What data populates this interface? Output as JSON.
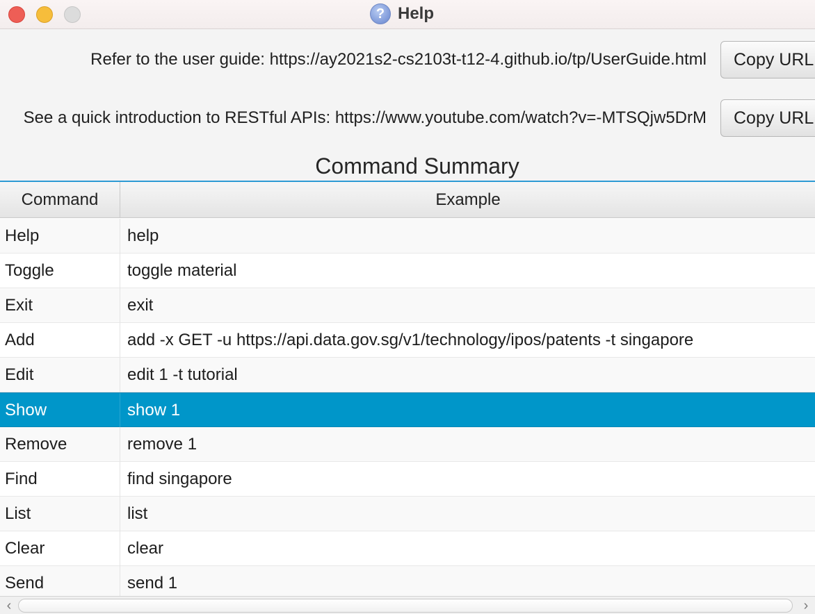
{
  "window": {
    "title": "Help"
  },
  "links": [
    {
      "text": "Refer to the user guide: https://ay2021s2-cs2103t-t12-4.github.io/tp/UserGuide.html",
      "button": "Copy URL"
    },
    {
      "text": "See a quick introduction to RESTful APIs: https://www.youtube.com/watch?v=-MTSQjw5DrM",
      "button": "Copy URL"
    }
  ],
  "summary": {
    "title": "Command Summary",
    "columns": [
      "Command",
      "Example"
    ],
    "rows": [
      {
        "command": "Help",
        "example": "help"
      },
      {
        "command": "Toggle",
        "example": "toggle material"
      },
      {
        "command": "Exit",
        "example": "exit"
      },
      {
        "command": "Add",
        "example": "add -x GET -u https://api.data.gov.sg/v1/technology/ipos/patents -t singapore"
      },
      {
        "command": "Edit",
        "example": "edit 1 -t tutorial"
      },
      {
        "command": "Show",
        "example": "show 1"
      },
      {
        "command": "Remove",
        "example": "remove 1"
      },
      {
        "command": "Find",
        "example": "find singapore"
      },
      {
        "command": "List",
        "example": "list"
      },
      {
        "command": "Clear",
        "example": "clear"
      },
      {
        "command": "Send",
        "example": "send 1"
      }
    ],
    "selected_row": "Show"
  },
  "colors": {
    "selection": "#0096c9",
    "table_accent": "#2d9ad4"
  }
}
